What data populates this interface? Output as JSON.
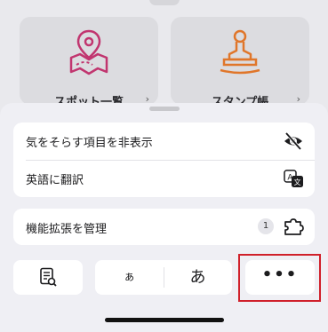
{
  "cards": [
    {
      "label": "スポット一覧",
      "chevron": "›",
      "icon": "map-pin-icon"
    },
    {
      "label": "スタンプ帳",
      "chevron": "›",
      "icon": "stamp-icon"
    }
  ],
  "menu": {
    "hide_distractions": {
      "label": "気をそらす項目を非表示",
      "icon": "eye-slash-icon"
    },
    "translate": {
      "label": "英語に翻訳",
      "icon": "translate-icon"
    },
    "extensions": {
      "label": "機能拡張を管理",
      "count": "1",
      "icon": "puzzle-icon"
    }
  },
  "toolbar": {
    "reader_icon": "reader-icon",
    "font_small": "ぁ",
    "font_large": "あ",
    "more": "•••"
  },
  "colors": {
    "accent_pink": "#c1356f",
    "accent_orange": "#e0762a",
    "highlight": "#d0202a"
  }
}
